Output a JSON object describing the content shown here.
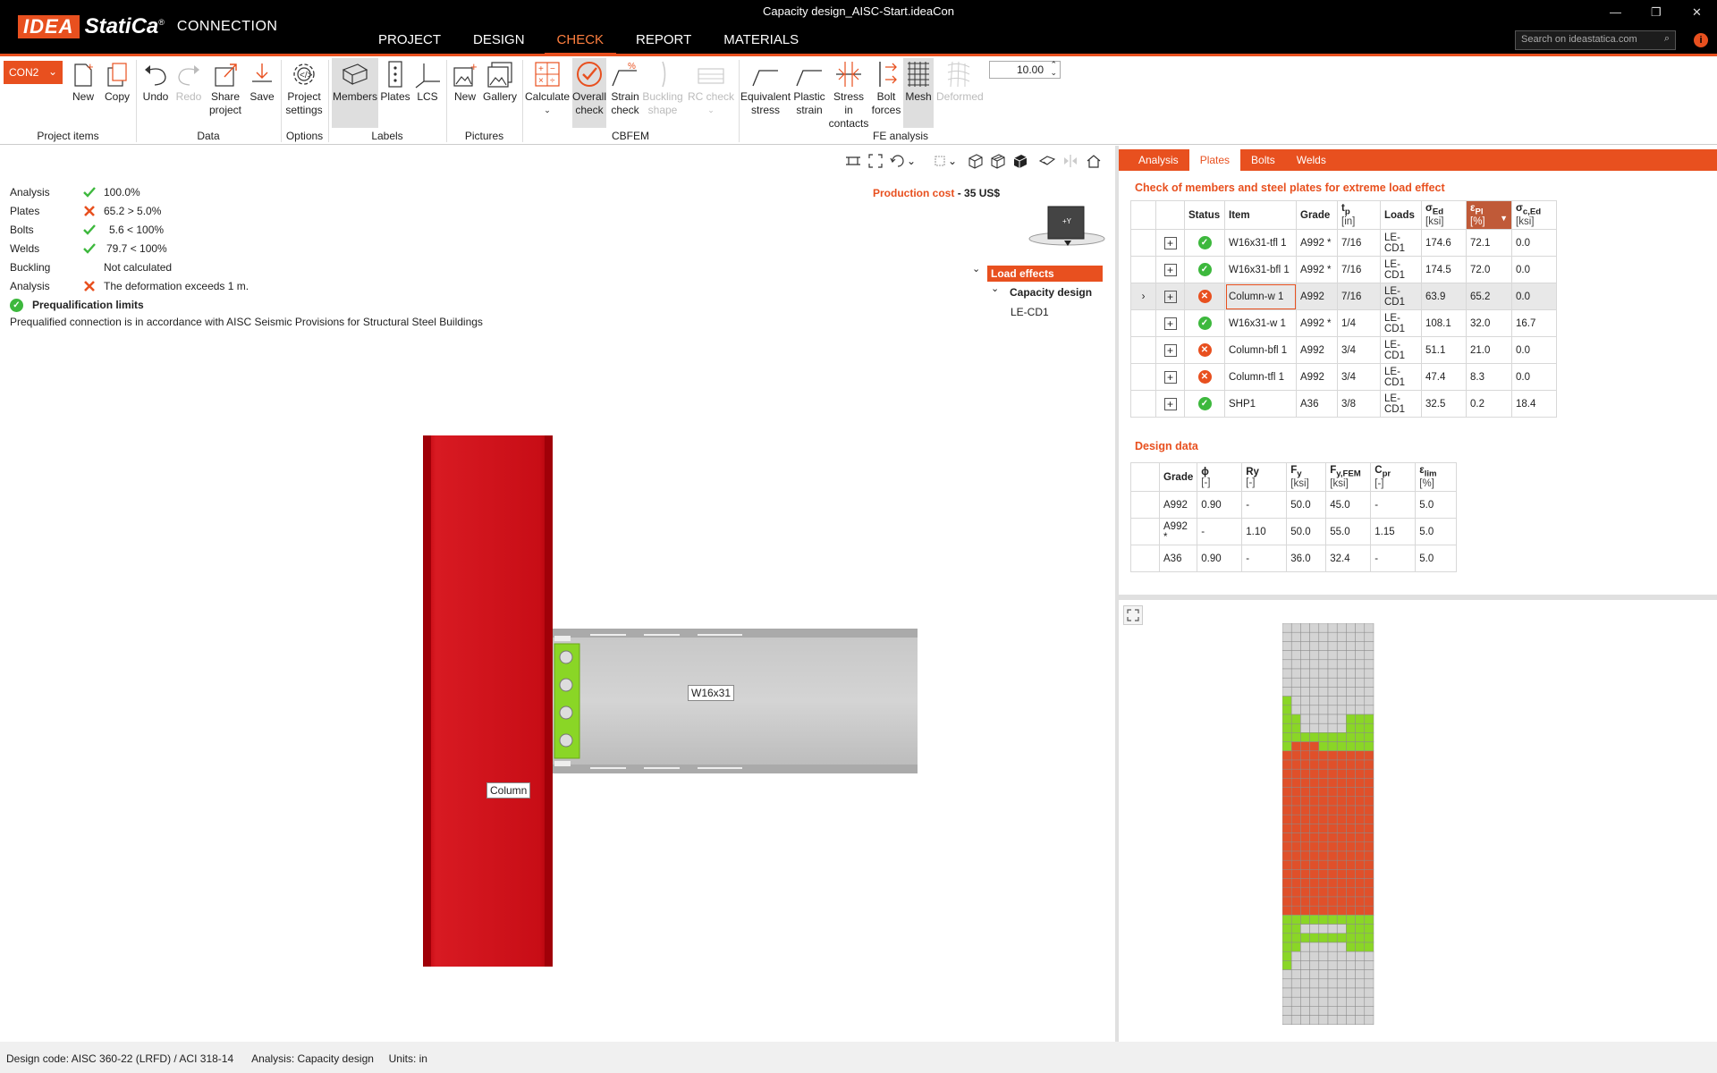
{
  "window": {
    "title": "Capacity design_AISC-Start.ideaCon",
    "app_brand": "IDEA",
    "app_brand2": "StatiCa",
    "app_module": "CONNECTION"
  },
  "menu": [
    {
      "label": "PROJECT"
    },
    {
      "label": "DESIGN"
    },
    {
      "label": "CHECK"
    },
    {
      "label": "REPORT"
    },
    {
      "label": "MATERIALS"
    }
  ],
  "search": {
    "placeholder": "Search on ideastatica.com"
  },
  "ribbon": {
    "connection_selector": "CON2",
    "new": "New",
    "copy": "Copy",
    "undo": "Undo",
    "redo": "Redo",
    "share_project_1": "Share",
    "share_project_2": "project",
    "save": "Save",
    "project_settings_1": "Project",
    "project_settings_2": "settings",
    "members": "Members",
    "plates": "Plates",
    "lcs": "LCS",
    "pic_new": "New",
    "gallery": "Gallery",
    "calculate": "Calculate",
    "overall_check_1": "Overall",
    "overall_check_2": "check",
    "strain_check_1": "Strain",
    "strain_check_2": "check",
    "buckling_shape_1": "Buckling",
    "buckling_shape_2": "shape",
    "rc_check": "RC check",
    "equivalent_stress_1": "Equivalent",
    "equivalent_stress_2": "stress",
    "plastic_strain_1": "Plastic",
    "plastic_strain_2": "strain",
    "stress_contacts_1": "Stress in",
    "stress_contacts_2": "contacts",
    "bolt_forces_1": "Bolt",
    "bolt_forces_2": "forces",
    "mesh": "Mesh",
    "deformed": "Deformed",
    "zoom_value": "10.00",
    "groups": {
      "project_items": "Project items",
      "data": "Data",
      "options": "Options",
      "labels": "Labels",
      "pictures": "Pictures",
      "cbfem": "CBFEM",
      "fe_analysis": "FE analysis"
    }
  },
  "summary": {
    "rows": [
      {
        "label": "Analysis",
        "status": "ok",
        "value": "100.0%"
      },
      {
        "label": "Plates",
        "status": "bad",
        "value": "65.2 > 5.0%"
      },
      {
        "label": "Bolts",
        "status": "ok",
        "value": "5.6 < 100%"
      },
      {
        "label": "Welds",
        "status": "ok",
        "value": "79.7 < 100%"
      },
      {
        "label": "Buckling",
        "status": "none",
        "value": "Not calculated"
      },
      {
        "label": "Analysis",
        "status": "bad",
        "value": "The deformation exceeds 1 m."
      }
    ],
    "prequal_title": "Prequalification limits",
    "prequal_text": "Prequalified connection is in accordance with AISC Seismic Provisions for Structural Steel Buildings"
  },
  "viewport": {
    "production_cost_label": "Production cost",
    "production_cost_value": "- 35 US$",
    "cube_label": "+Y",
    "tree": {
      "root": "Load effects",
      "child": "Capacity design",
      "leaf": "LE-CD1"
    },
    "beam_label": "W16x31",
    "column_label": "Column"
  },
  "right_tabs": [
    {
      "label": "Analysis"
    },
    {
      "label": "Plates"
    },
    {
      "label": "Bolts"
    },
    {
      "label": "Welds"
    }
  ],
  "plates_table": {
    "title": "Check of members and steel plates for extreme load effect",
    "headers": {
      "status": "Status",
      "item": "Item",
      "grade": "Grade",
      "tp": "t",
      "tp_sub": "p",
      "tp_unit": "[in]",
      "loads": "Loads",
      "sed": "σ",
      "sed_sub": "Ed",
      "sed_unit": "[ksi]",
      "epl": "ε",
      "epl_sub": "Pl",
      "epl_unit": "[%]",
      "sced": "σ",
      "sced_sub": "c,Ed",
      "sced_unit": "[ksi]"
    },
    "rows": [
      {
        "status": "ok",
        "item": "W16x31-tfl 1",
        "grade": "A992 *",
        "tp": "7/16",
        "loads": "LE-CD1",
        "sed": "174.6",
        "epl": "72.1",
        "sced": "0.0"
      },
      {
        "status": "ok",
        "item": "W16x31-bfl 1",
        "grade": "A992 *",
        "tp": "7/16",
        "loads": "LE-CD1",
        "sed": "174.5",
        "epl": "72.0",
        "sced": "0.0"
      },
      {
        "status": "bad",
        "item": "Column-w 1",
        "grade": "A992",
        "tp": "7/16",
        "loads": "LE-CD1",
        "sed": "63.9",
        "epl": "65.2",
        "sced": "0.0"
      },
      {
        "status": "ok",
        "item": "W16x31-w 1",
        "grade": "A992 *",
        "tp": "1/4",
        "loads": "LE-CD1",
        "sed": "108.1",
        "epl": "32.0",
        "sced": "16.7"
      },
      {
        "status": "bad",
        "item": "Column-bfl 1",
        "grade": "A992",
        "tp": "3/4",
        "loads": "LE-CD1",
        "sed": "51.1",
        "epl": "21.0",
        "sced": "0.0"
      },
      {
        "status": "bad",
        "item": "Column-tfl 1",
        "grade": "A992",
        "tp": "3/4",
        "loads": "LE-CD1",
        "sed": "47.4",
        "epl": "8.3",
        "sced": "0.0"
      },
      {
        "status": "ok",
        "item": "SHP1",
        "grade": "A36",
        "tp": "3/8",
        "loads": "LE-CD1",
        "sed": "32.5",
        "epl": "0.2",
        "sced": "18.4"
      }
    ]
  },
  "design_table": {
    "title": "Design data",
    "headers": {
      "grade": "Grade",
      "phi": "ϕ",
      "phi_unit": "[-]",
      "ry": "Ry",
      "ry_unit": "[-]",
      "fy": "F",
      "fy_sub": "y",
      "fy_unit": "[ksi]",
      "fyfem": "F",
      "fyfem_sub": "y,FEM",
      "fyfem_unit": "[ksi]",
      "cpr": "C",
      "cpr_sub": "pr",
      "cpr_unit": "[-]",
      "elim": "ε",
      "elim_sub": "lim",
      "elim_unit": "[%]"
    },
    "rows": [
      {
        "grade": "A992",
        "phi": "0.90",
        "ry": "-",
        "fy": "50.0",
        "fyfem": "45.0",
        "cpr": "-",
        "elim": "5.0"
      },
      {
        "grade": "A992 *",
        "phi": "-",
        "ry": "1.10",
        "fy": "50.0",
        "fyfem": "55.0",
        "cpr": "1.15",
        "elim": "5.0"
      },
      {
        "grade": "A36",
        "phi": "0.90",
        "ry": "-",
        "fy": "36.0",
        "fyfem": "32.4",
        "cpr": "-",
        "elim": "5.0"
      }
    ]
  },
  "statusbar": {
    "design_code_label": "Design code:",
    "design_code_value": "AISC 360-22 (LRFD) / ACI 318-14",
    "analysis_label": "Analysis:",
    "analysis_value": "Capacity design",
    "units_label": "Units:",
    "units_value": "in"
  },
  "colors": {
    "accent": "#e8501f",
    "column": "#d0101a",
    "ok": "#3db83d",
    "mesh_red": "#e0502a",
    "mesh_green": "#8ad626"
  }
}
